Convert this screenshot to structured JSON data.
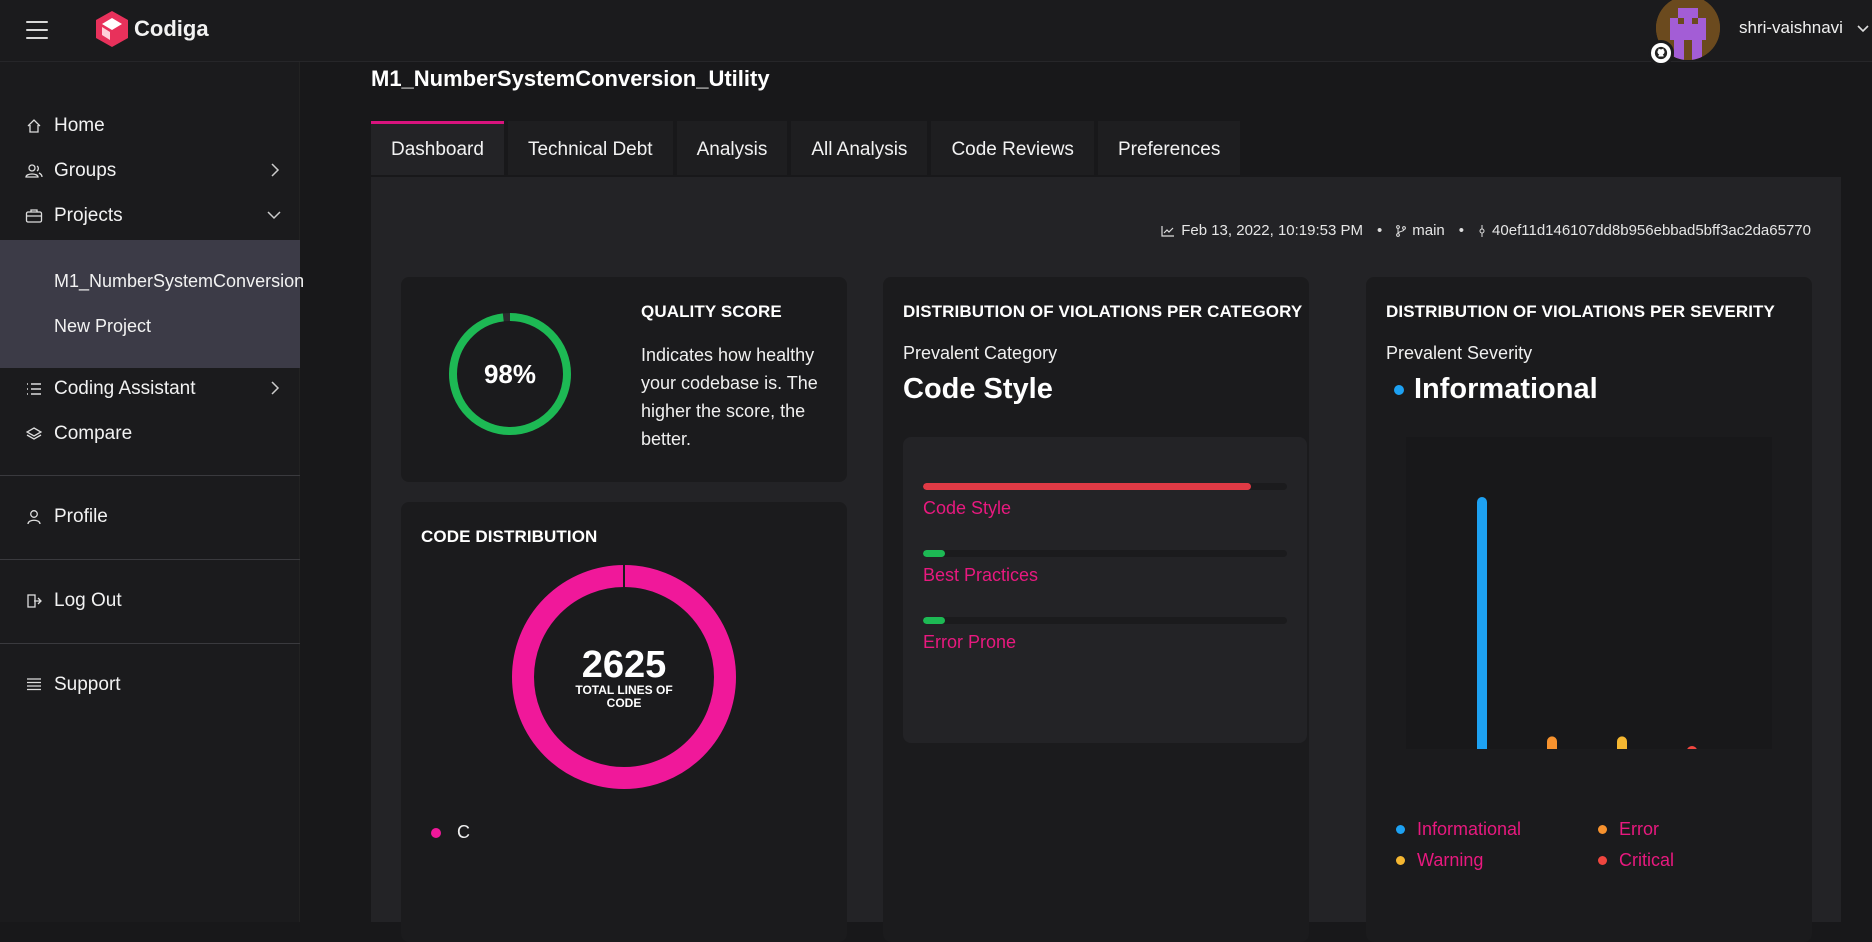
{
  "app": {
    "brand": "Codiga",
    "brand_color": "#e8315b",
    "accent": "#d9137e"
  },
  "user": {
    "name": "shri-vaishnavi",
    "badge_icon": "github-icon"
  },
  "sidebar": {
    "items": [
      {
        "label": "Home",
        "icon": "home-icon"
      },
      {
        "label": "Groups",
        "icon": "groups-icon"
      },
      {
        "label": "Projects",
        "icon": "briefcase-icon"
      },
      {
        "label": "Coding Assistant",
        "icon": "list-icon"
      },
      {
        "label": "Compare",
        "icon": "layers-icon"
      },
      {
        "label": "Profile",
        "icon": "user-icon"
      },
      {
        "label": "Log Out",
        "icon": "logout-icon"
      },
      {
        "label": "Support",
        "icon": "support-icon"
      }
    ],
    "projects": [
      "M1_NumberSystemConversion",
      "New Project"
    ]
  },
  "main": {
    "project_title": "M1_NumberSystemConversion_Utility",
    "tabs": [
      "Dashboard",
      "Technical Debt",
      "Analysis",
      "All Analysis",
      "Code Reviews",
      "Preferences"
    ],
    "active_tab": "Dashboard",
    "meta": {
      "date": "Feb 13, 2022, 10:19:53 PM",
      "branch": "main",
      "commit": "40ef11d146107dd8b956ebbad5bff3ac2da65770"
    }
  },
  "quality": {
    "title": "QUALITY SCORE",
    "score_text": "98%",
    "score": 98,
    "description": "Indicates how healthy your codebase is. The higher the score, the better.",
    "ring_color": "#1db954"
  },
  "code_distribution": {
    "title": "CODE DISTRIBUTION",
    "total": "2625",
    "total_label": "TOTAL LINES OF CODE",
    "legend": "C",
    "color": "#f0189a"
  },
  "category": {
    "title": "DISTRIBUTION OF VIOLATIONS PER CATEGORY",
    "prevalent_label": "Prevalent Category",
    "prevalent_value": "Code Style",
    "bars": [
      {
        "label": "Code Style",
        "fraction": 0.9,
        "color": "#e03a45"
      },
      {
        "label": "Best Practices",
        "fraction": 0.06,
        "color": "#1db954"
      },
      {
        "label": "Error Prone",
        "fraction": 0.06,
        "color": "#1db954"
      }
    ]
  },
  "severity": {
    "title": "DISTRIBUTION OF VIOLATIONS PER SEVERITY",
    "prevalent_label": "Prevalent Severity",
    "prevalent_value": "Informational",
    "legend": [
      {
        "label": "Informational",
        "color": "#1da1f2"
      },
      {
        "label": "Error",
        "color": "#f7922e"
      },
      {
        "label": "Warning",
        "color": "#f5b731"
      },
      {
        "label": "Critical",
        "color": "#f0463f"
      }
    ]
  },
  "chart_data": {
    "type": "bar",
    "categories": [
      "Informational",
      "Error",
      "Warning",
      "Critical"
    ],
    "values": [
      100,
      5,
      5,
      0.5
    ],
    "title": "",
    "xlabel": "",
    "ylabel": "",
    "ylim": [
      0,
      100
    ],
    "grid": false,
    "legend": "bottom",
    "colors": [
      "#1da1f2",
      "#f7922e",
      "#f5b731",
      "#f0463f"
    ]
  }
}
